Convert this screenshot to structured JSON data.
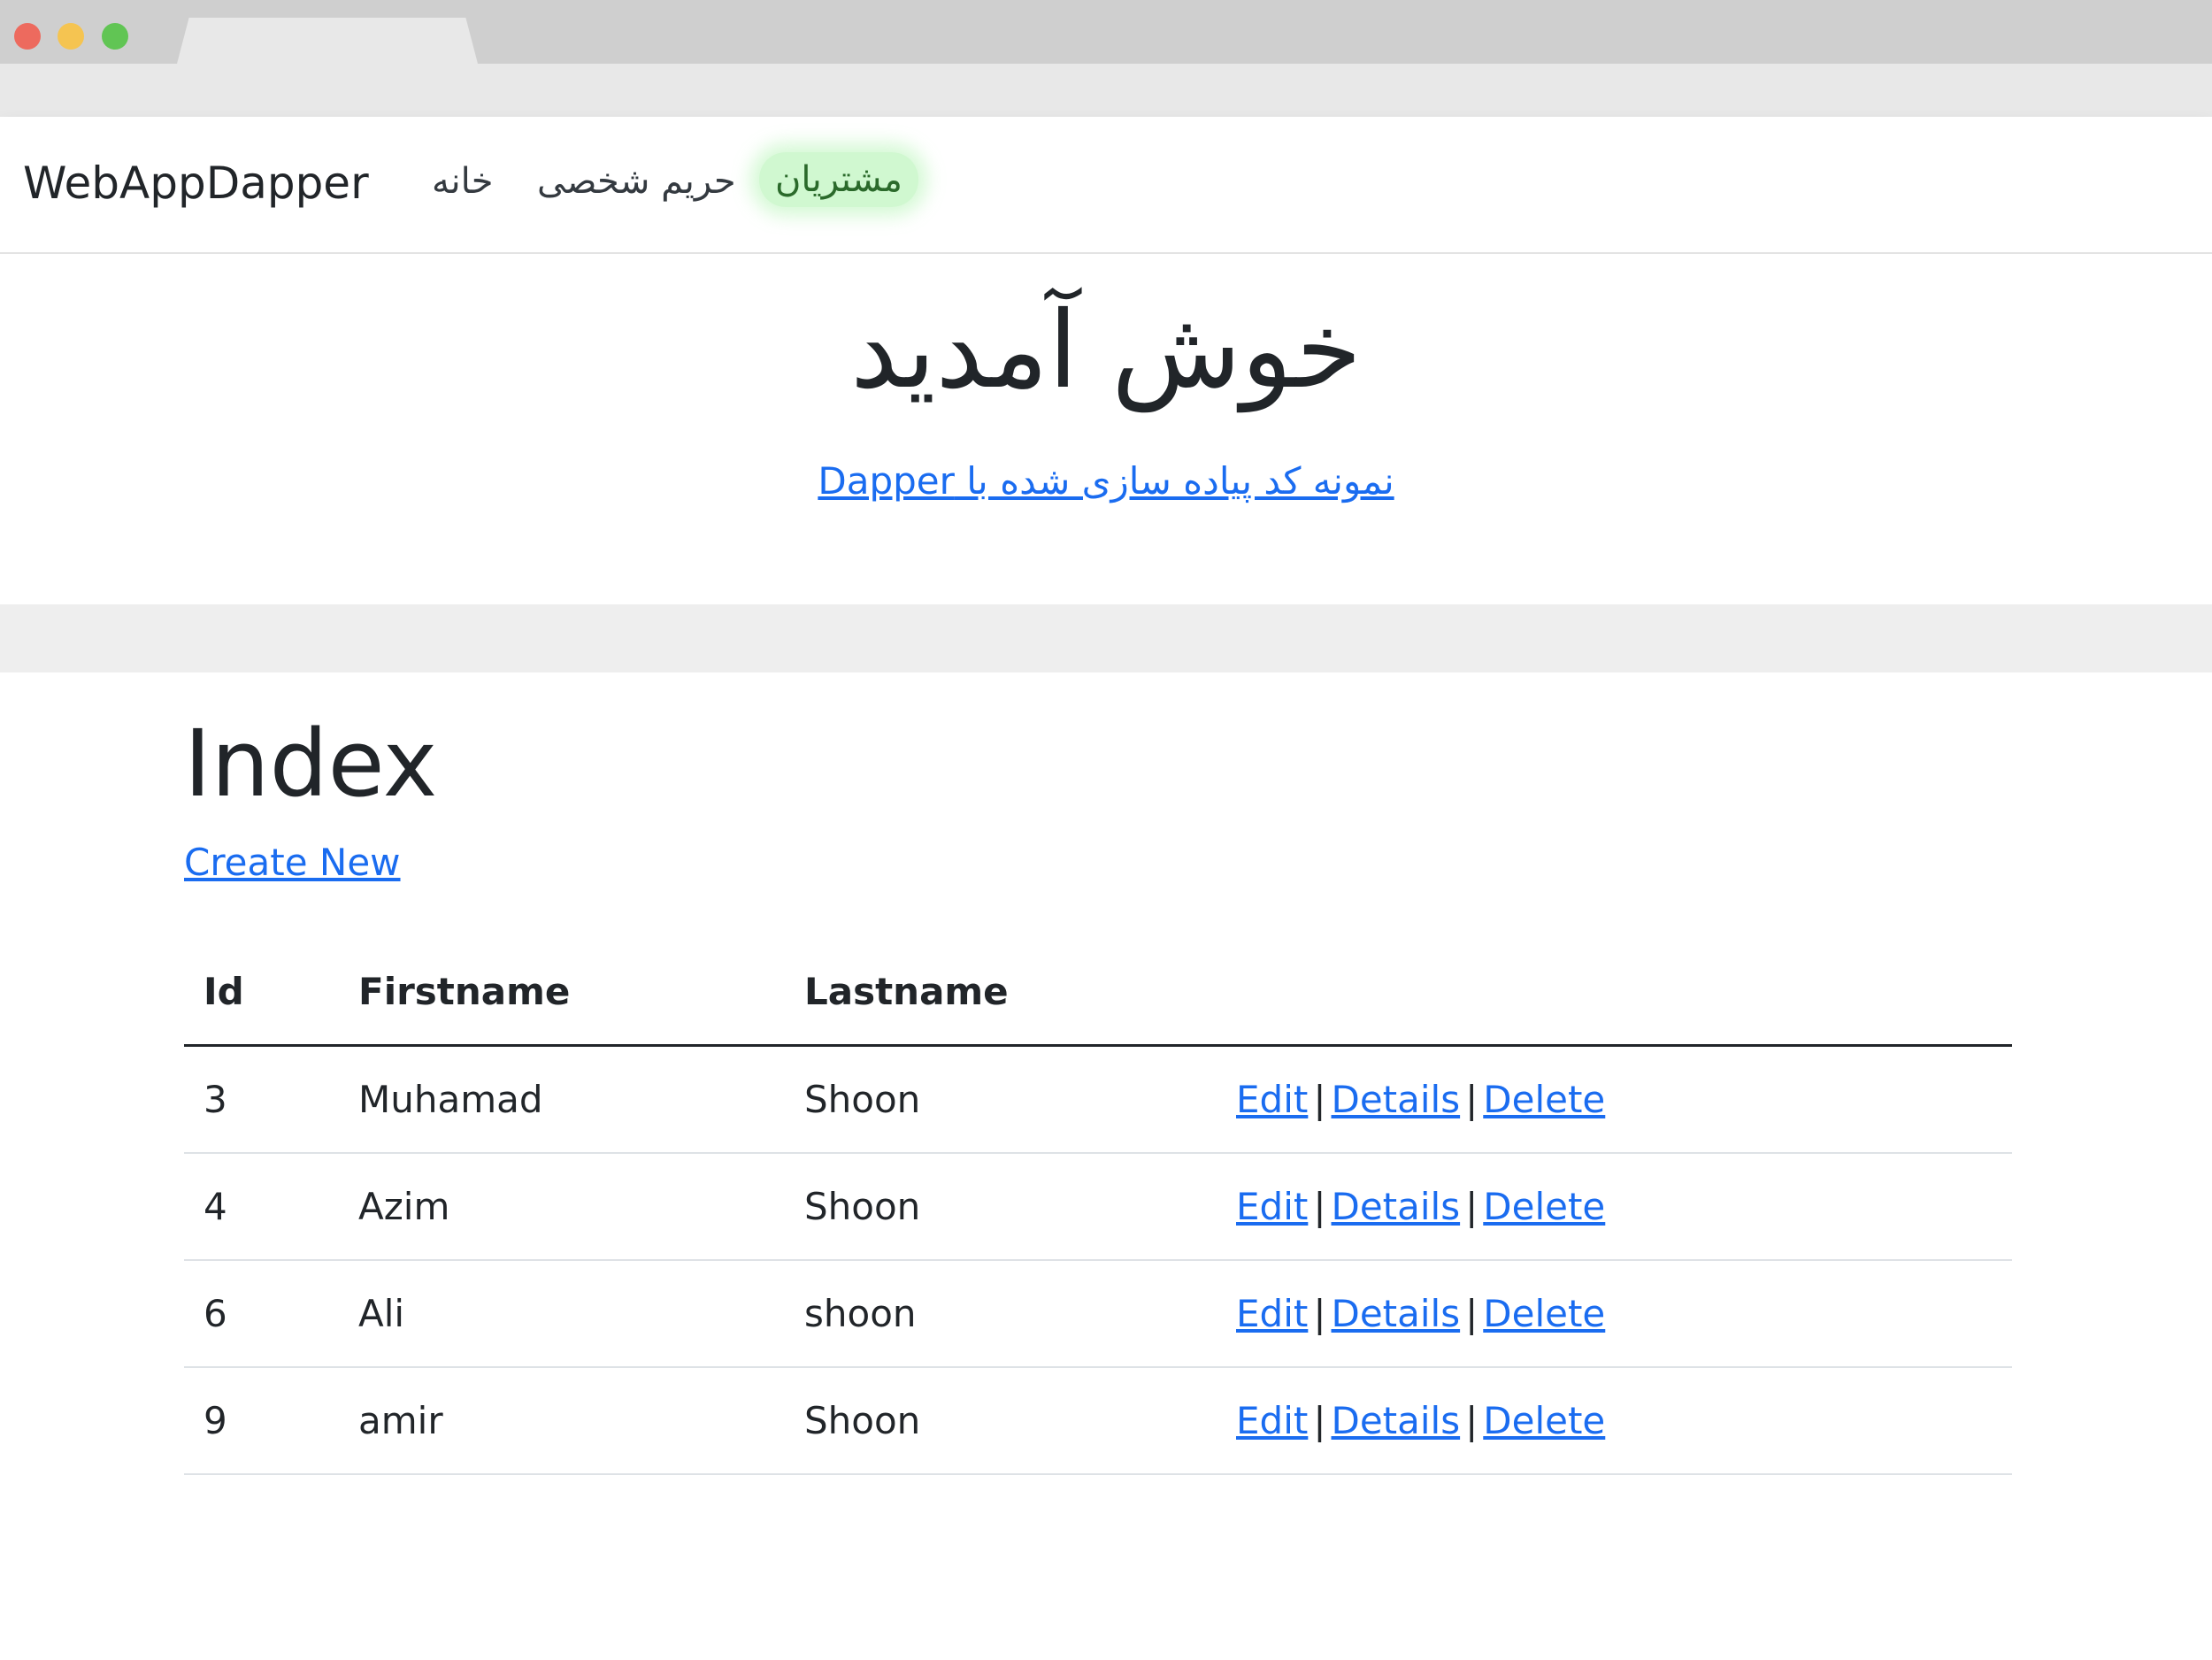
{
  "navbar": {
    "brand": "WebAppDapper",
    "items": [
      {
        "label": "خانه"
      },
      {
        "label": "حریم شخصی"
      },
      {
        "label": "مشتریان"
      }
    ]
  },
  "hero": {
    "title": "خوش آمدید",
    "link": "نمونه کد پیاده سازی شده با Dapper"
  },
  "main": {
    "title": "Index",
    "create_new": "Create New",
    "table": {
      "headers": [
        "Id",
        "Firstname",
        "Lastname"
      ],
      "rows": [
        {
          "id": "3",
          "firstname": "Muhamad",
          "lastname": "Shoon"
        },
        {
          "id": "4",
          "firstname": "Azim",
          "lastname": "Shoon"
        },
        {
          "id": "6",
          "firstname": "Ali",
          "lastname": "shoon"
        },
        {
          "id": "9",
          "firstname": "amir",
          "lastname": "Shoon"
        }
      ],
      "actions": {
        "edit": "Edit",
        "details": "Details",
        "delete": "Delete",
        "separator": "|"
      }
    }
  },
  "colors": {
    "link": "#1a6cf0",
    "active_highlight": "#96f096"
  }
}
